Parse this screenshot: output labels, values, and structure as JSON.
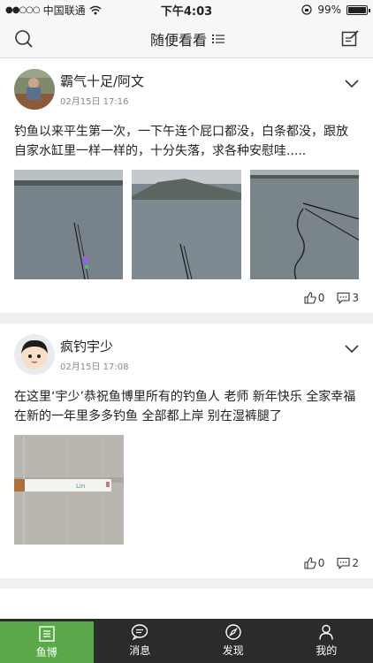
{
  "status_bar": {
    "carrier": "中国联通",
    "time": "下午4:03",
    "battery": "99%",
    "battery_level": 0.99
  },
  "nav": {
    "title": "随便看看",
    "left_icon": "search-icon",
    "right_icon": "edit-icon"
  },
  "posts": [
    {
      "username": "霸气十足/阿文",
      "time": "02月15日 17:16",
      "text": "钓鱼以来平生第一次，一下午连个屁口都没，白条都没，跟放自家水缸里一样一样的，十分失落，求各种安慰哇.....",
      "likes": "0",
      "comments": "3"
    },
    {
      "username": "疯钓宇少",
      "time": "02月15日 17:08",
      "text": "在这里‘宇少’恭祝鱼博里所有的钓鱼人 老师 新年快乐 全家幸福 在新的一年里多多钓鱼 全部都上岸 别在湿裤腿了",
      "likes": "0",
      "comments": "2"
    }
  ],
  "tabs": [
    {
      "label": "鱼博",
      "icon": "feed-icon",
      "active": true
    },
    {
      "label": "消息",
      "icon": "message-icon",
      "active": false
    },
    {
      "label": "发现",
      "icon": "compass-icon",
      "active": false
    },
    {
      "label": "我的",
      "icon": "person-icon",
      "active": false
    }
  ],
  "colors": {
    "accent": "#5aa84a",
    "tabbar": "#2b2b2b"
  }
}
